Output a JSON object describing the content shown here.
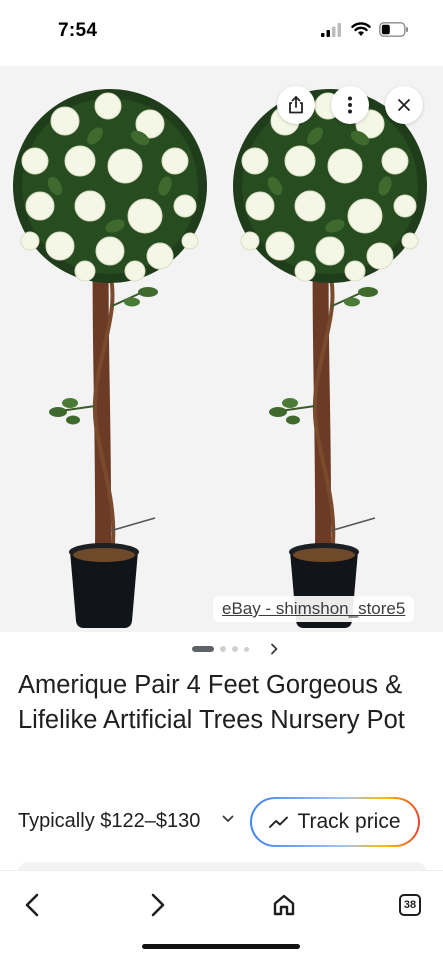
{
  "status_bar": {
    "time": "7:54"
  },
  "hero": {
    "source": "eBay - shimshon_store5",
    "buttons": {
      "share": "share-icon",
      "more": "more-vert-icon",
      "close": "close-icon"
    }
  },
  "pager": {
    "active_index": 0,
    "total_dots": 4
  },
  "product": {
    "title": "Amerique Pair 4 Feet Gorgeous & Lifelike Artificial Trees Nursery Pot"
  },
  "price": {
    "label": "Typically",
    "range": "$122–$130"
  },
  "track_price": {
    "label": "Track price"
  },
  "bottom_nav": {
    "back": "back-icon",
    "forward": "forward-icon",
    "home": "home-icon",
    "tabs_count": "38"
  },
  "colors": {
    "brand_blue": "#4285f4",
    "text": "#1f1f1f",
    "hero_bg": "#f3f3f3"
  }
}
